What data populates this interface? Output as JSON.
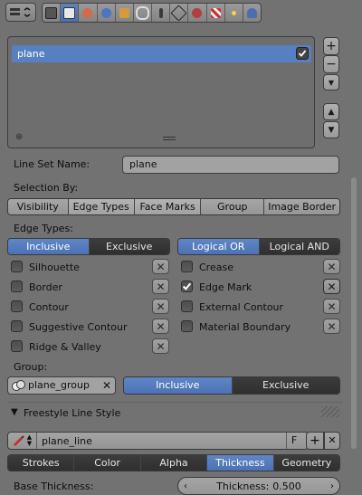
{
  "list": {
    "items": [
      {
        "label": "plane",
        "checked": true
      }
    ]
  },
  "lineset": {
    "name_label": "Line Set Name:",
    "name_value": "plane"
  },
  "selection": {
    "label": "Selection By:",
    "tabs": [
      "Visibility",
      "Edge Types",
      "Face Marks",
      "Group",
      "Image Border"
    ],
    "active": [
      "Edge Types",
      "Face Marks"
    ]
  },
  "edge_types": {
    "label": "Edge Types:",
    "mode_left": [
      "Inclusive",
      "Exclusive"
    ],
    "mode_right": [
      "Logical OR",
      "Logical AND"
    ],
    "left": [
      {
        "label": "Silhouette",
        "checked": false
      },
      {
        "label": "Border",
        "checked": false
      },
      {
        "label": "Contour",
        "checked": false
      },
      {
        "label": "Suggestive Contour",
        "checked": false
      },
      {
        "label": "Ridge & Valley",
        "checked": false
      }
    ],
    "right": [
      {
        "label": "Crease",
        "checked": false
      },
      {
        "label": "Edge Mark",
        "checked": true
      },
      {
        "label": "External Contour",
        "checked": false
      },
      {
        "label": "Material Boundary",
        "checked": false
      }
    ]
  },
  "group": {
    "label": "Group:",
    "value": "plane_group",
    "modes": [
      "Inclusive",
      "Exclusive"
    ],
    "active": "Inclusive"
  },
  "line_style": {
    "section_title": "Freestyle Line Style",
    "name": "plane_line",
    "fake_user": "F",
    "tabs": [
      "Strokes",
      "Color",
      "Alpha",
      "Thickness",
      "Geometry"
    ],
    "active_tab": "Thickness",
    "base_thickness_label": "Base Thickness:",
    "thickness_label": "Thickness:",
    "thickness_value": "0.500"
  },
  "colors": {
    "accent": "#5680c2",
    "panel_bg": "#727272"
  }
}
